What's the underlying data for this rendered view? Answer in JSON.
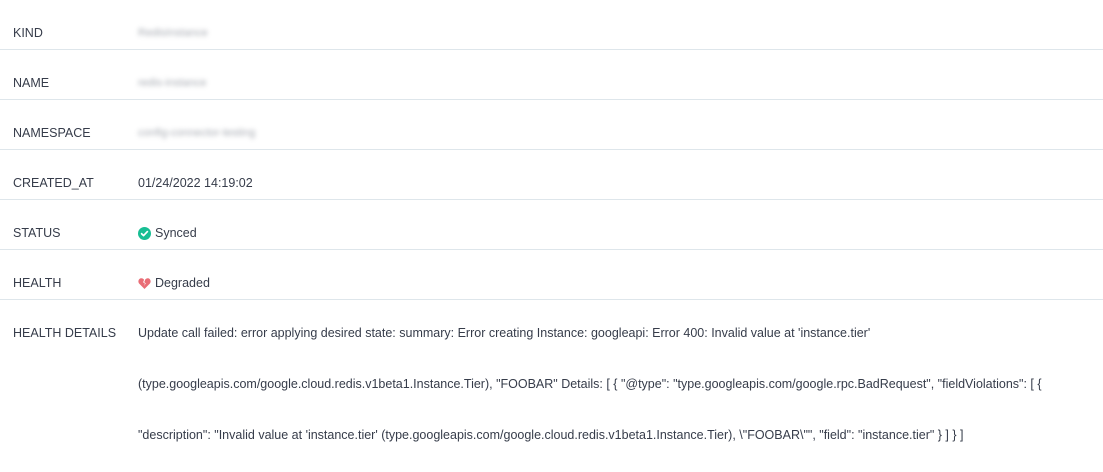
{
  "rows": [
    {
      "key": "KIND",
      "value": "RedisInstance",
      "blurred": true
    },
    {
      "key": "NAME",
      "value": "redis-instance",
      "blurred": true
    },
    {
      "key": "NAMESPACE",
      "value": "config-connector-testing",
      "blurred": true
    },
    {
      "key": "CREATED_AT",
      "value": "01/24/2022 14:19:02"
    },
    {
      "key": "STATUS",
      "value": "Synced",
      "icon": "check-circle-icon",
      "icon_color": "#18be94"
    },
    {
      "key": "HEALTH",
      "value": "Degraded",
      "icon": "broken-heart-icon",
      "icon_color": "#e96d76"
    }
  ],
  "health_details": {
    "key": "HEALTH DETAILS",
    "lines": [
      "Update call failed: error applying desired state: summary: Error creating Instance: googleapi: Error 400: Invalid value at 'instance.tier'",
      "(type.googleapis.com/google.cloud.redis.v1beta1.Instance.Tier), \"FOOBAR\" Details: [ { \"@type\": \"type.googleapis.com/google.rpc.BadRequest\", \"fieldViolations\": [ {",
      "\"description\": \"Invalid value at 'instance.tier' (type.googleapis.com/google.cloud.redis.v1beta1.Instance.Tier), \\\"FOOBAR\\\"\", \"field\": \"instance.tier\" } ] } ]"
    ]
  }
}
